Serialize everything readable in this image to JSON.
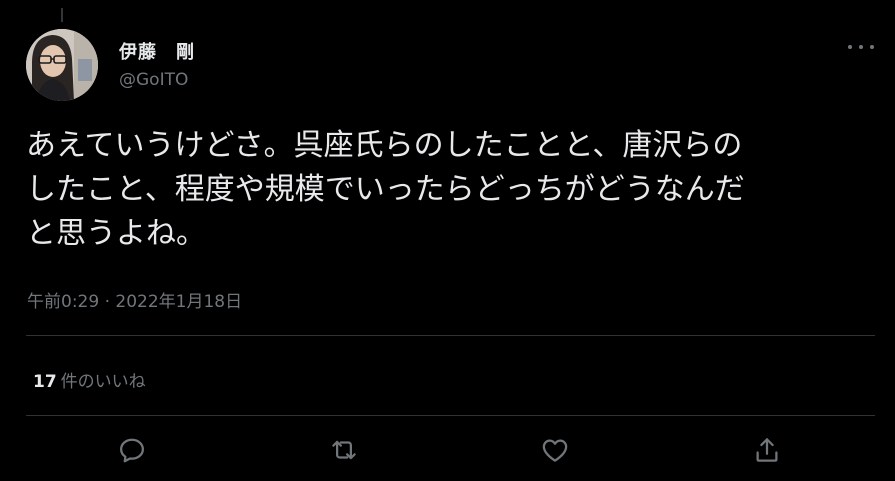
{
  "author": {
    "display_name": "伊藤　剛",
    "handle": "@GoITO"
  },
  "tweet": {
    "text_lines": [
      "あえていうけどさ。呉座氏らのしたことと、唐沢らの",
      "したこと、程度や規模でいったらどっちがどうなんだ",
      "と思うよね。"
    ],
    "timestamp": "午前0:29 · 2022年1月18日"
  },
  "stats": {
    "likes_count": "17",
    "likes_label": "件のいいね"
  },
  "actions": {
    "reply": "reply-icon",
    "retweet": "retweet-icon",
    "like": "heart-icon",
    "share": "share-icon"
  },
  "colors": {
    "background": "#000000",
    "text_primary": "#e7e9ea",
    "text_secondary": "#71767b",
    "divider": "#2f3336"
  }
}
